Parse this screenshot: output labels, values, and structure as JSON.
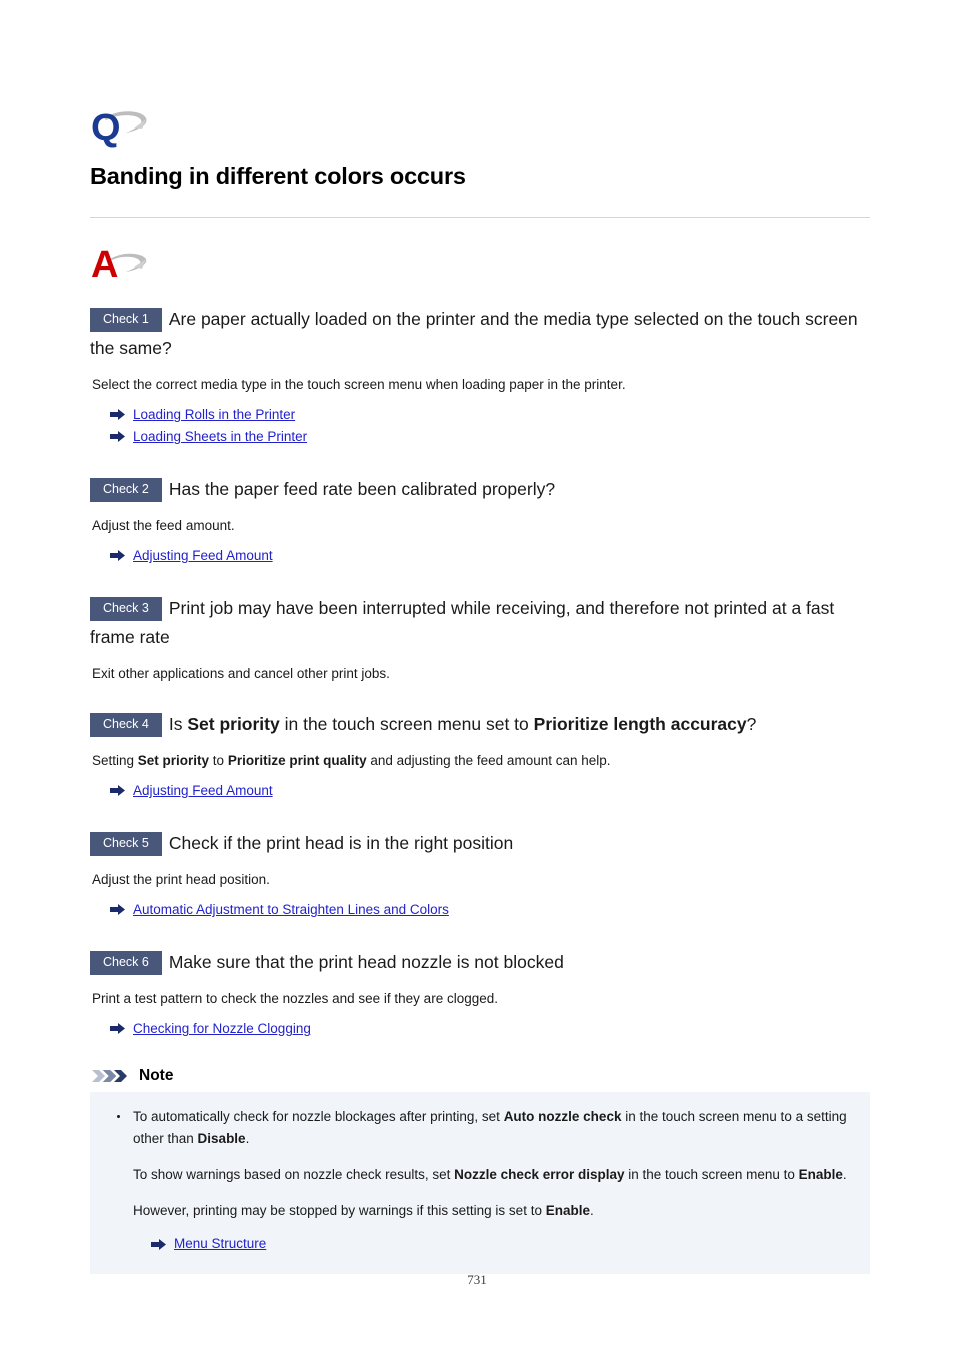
{
  "document": {
    "title": "Banding in different colors occurs",
    "page_number": "731",
    "question_icon": "q-mark-icon",
    "answer_icon": "a-mark-icon"
  },
  "checks": [
    {
      "badge": "Check 1",
      "heading_parts": [
        {
          "text": "Are paper actually loaded on the printer and the media type selected on the touch screen the same?",
          "bold": false
        }
      ],
      "body_parts": [
        {
          "text": "Select the correct media type in the touch screen menu when loading paper in the printer.",
          "bold": false
        }
      ],
      "links": [
        "Loading Rolls in the Printer",
        "Loading Sheets in the Printer"
      ]
    },
    {
      "badge": "Check 2",
      "heading_parts": [
        {
          "text": "Has the paper feed rate been calibrated properly?",
          "bold": false
        }
      ],
      "body_parts": [
        {
          "text": "Adjust the feed amount.",
          "bold": false
        }
      ],
      "links": [
        "Adjusting Feed Amount"
      ]
    },
    {
      "badge": "Check 3",
      "heading_parts": [
        {
          "text": "Print job may have been interrupted while receiving, and therefore not printed at a fast frame rate",
          "bold": false
        }
      ],
      "body_parts": [
        {
          "text": "Exit other applications and cancel other print jobs.",
          "bold": false
        }
      ],
      "links": []
    },
    {
      "badge": "Check 4",
      "heading_parts": [
        {
          "text": "Is ",
          "bold": false
        },
        {
          "text": "Set priority",
          "bold": true
        },
        {
          "text": " in the touch screen menu set to ",
          "bold": false
        },
        {
          "text": "Prioritize length accuracy",
          "bold": true
        },
        {
          "text": "?",
          "bold": false
        }
      ],
      "body_parts": [
        {
          "text": "Setting ",
          "bold": false
        },
        {
          "text": "Set priority",
          "bold": true
        },
        {
          "text": " to ",
          "bold": false
        },
        {
          "text": "Prioritize print quality",
          "bold": true
        },
        {
          "text": " and adjusting the feed amount can help.",
          "bold": false
        }
      ],
      "links": [
        "Adjusting Feed Amount"
      ]
    },
    {
      "badge": "Check 5",
      "heading_parts": [
        {
          "text": "Check if the print head is in the right position",
          "bold": false
        }
      ],
      "body_parts": [
        {
          "text": "Adjust the print head position.",
          "bold": false
        }
      ],
      "links": [
        "Automatic Adjustment to Straighten Lines and Colors"
      ]
    },
    {
      "badge": "Check 6",
      "heading_parts": [
        {
          "text": "Make sure that the print head nozzle is not blocked",
          "bold": false
        }
      ],
      "body_parts": [
        {
          "text": "Print a test pattern to check the nozzles and see if they are clogged.",
          "bold": false
        }
      ],
      "links": [
        "Checking for Nozzle Clogging"
      ]
    }
  ],
  "note": {
    "label": "Note",
    "icon": "triple-chevron-icon",
    "paragraphs": [
      [
        {
          "text": "To automatically check for nozzle blockages after printing, set ",
          "bold": false
        },
        {
          "text": "Auto nozzle check",
          "bold": true
        },
        {
          "text": " in the touch screen menu to a setting other than ",
          "bold": false
        },
        {
          "text": "Disable",
          "bold": true
        },
        {
          "text": ".",
          "bold": false
        }
      ],
      [
        {
          "text": "To show warnings based on nozzle check results, set ",
          "bold": false
        },
        {
          "text": "Nozzle check error display",
          "bold": true
        },
        {
          "text": " in the touch screen menu to ",
          "bold": false
        },
        {
          "text": "Enable",
          "bold": true
        },
        {
          "text": ".",
          "bold": false
        }
      ],
      [
        {
          "text": "However, printing may be stopped by warnings if this setting is set to ",
          "bold": false
        },
        {
          "text": "Enable",
          "bold": true
        },
        {
          "text": ".",
          "bold": false
        }
      ]
    ],
    "links": [
      "Menu Structure"
    ]
  },
  "colors": {
    "badge_background": "#49577a",
    "badge_text": "#ffffff",
    "link": "#2222cc",
    "note_background": "#f1f4f9",
    "q_icon": "#1b3a93",
    "a_icon": "#cc0000",
    "swoosh": "#b9b9b9",
    "rule": "#d4d4d4"
  }
}
